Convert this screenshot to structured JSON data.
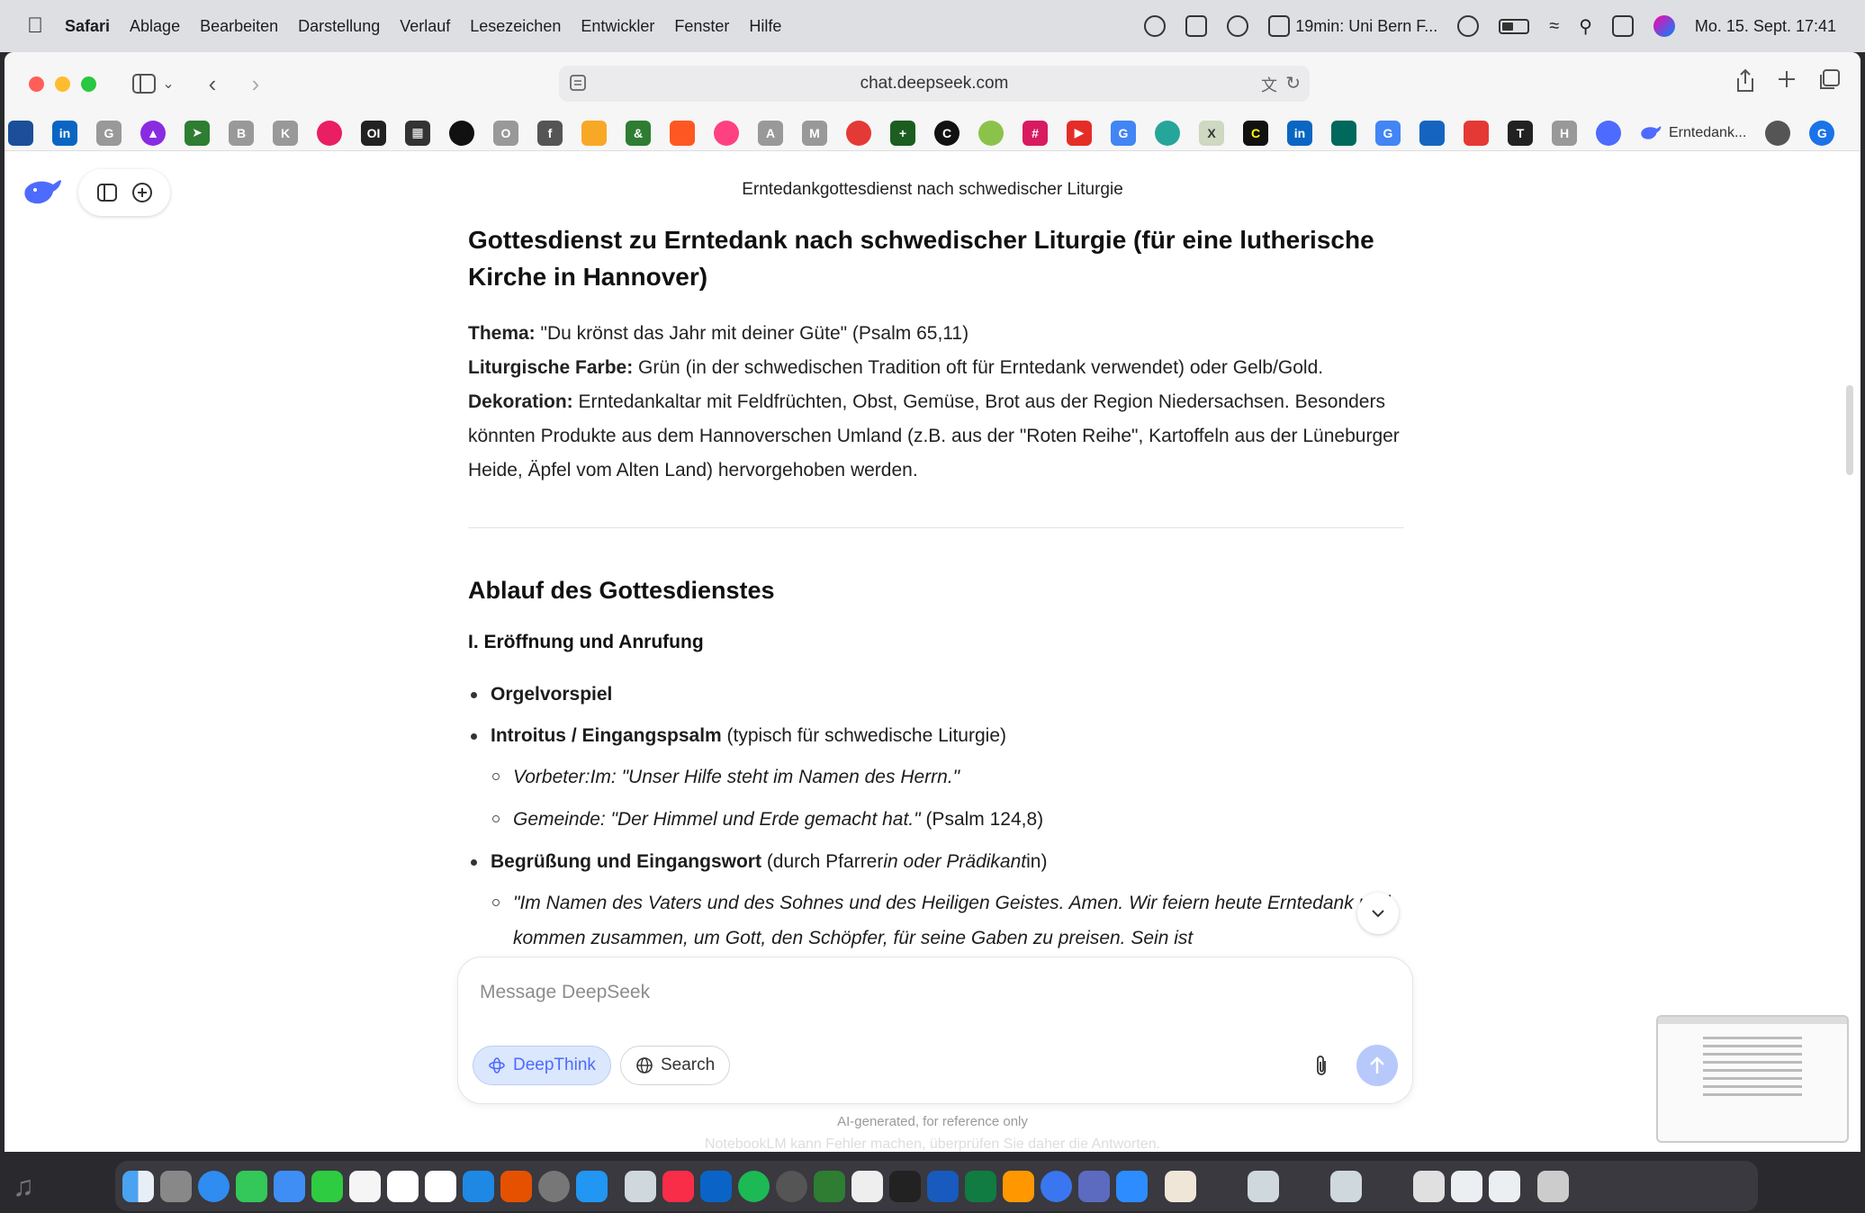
{
  "menubar": {
    "app_name": "Safari",
    "menus": [
      "Ablage",
      "Bearbeiten",
      "Darstellung",
      "Verlauf",
      "Lesezeichen",
      "Entwickler",
      "Fenster",
      "Hilfe"
    ],
    "meeting": "19min:  Uni Bern F...",
    "datetime": "Mo. 15. Sept.  17:41"
  },
  "browser": {
    "url": "chat.deepseek.com",
    "active_tab_label": "Erntedank..."
  },
  "chat": {
    "title": "Erntedankgottesdienst nach schwedischer Liturgie",
    "heading": "Gottesdienst zu Erntedank nach schwedischer Liturgie (für eine lutherische Kirche in Hannover)",
    "info": {
      "thema_label": "Thema:",
      "thema_value": "\"Du krönst das Jahr mit deiner Güte\" (Psalm 65,11)",
      "farbe_label": "Liturgische Farbe:",
      "farbe_value": "Grün (in der schwedischen Tradition oft für Erntedank verwendet) oder Gelb/Gold.",
      "deko_label": "Dekoration:",
      "deko_value": "Erntedankaltar mit Feldfrüchten, Obst, Gemüse, Brot aus der Region Niedersachsen. Besonders könnten Produkte aus dem Hannoverschen Umland (z.B. aus der \"Roten Reihe\", Kartoffeln aus der Lüneburger Heide, Äpfel vom Alten Land) hervorgehoben werden."
    },
    "section_heading": "Ablauf des Gottesdienstes",
    "subsection_heading": "I. Eröffnung und Anrufung",
    "items": {
      "orgel": "Orgelvorspiel",
      "introitus_bold": "Introitus / Eingangspsalm",
      "introitus_rest": " (typisch für schwedische Liturgie)",
      "vorbeter": "Vorbeter:Im: \"Unser Hilfe steht im Namen des Herrn.\"",
      "gemeinde_italic": "Gemeinde: \"Der Himmel und Erde gemacht hat.\"",
      "gemeinde_ref": " (Psalm 124,8)",
      "begruessung_bold": "Begrüßung und Eingangswort",
      "begruessung_pre": " (durch Pfarrer",
      "begruessung_italic": "in oder Prädikant",
      "begruessung_post": "in)",
      "quote": "\"Im Namen des Vaters und des Sohnes und des Heiligen Geistes. Amen. Wir feiern heute Erntedank und kommen zusammen, um Gott, den Schöpfer, für seine Gaben zu preisen. Sein ist"
    }
  },
  "composer": {
    "placeholder": "Message DeepSeek",
    "deepthink_label": "DeepThink",
    "search_label": "Search",
    "disclaimer": "AI-generated, for reference only"
  },
  "background_text": "NotebookLM kann Fehler machen, überprüfen Sie daher die Antworten.",
  "colors": {
    "accent": "#4d6bfe",
    "send_disabled": "#b7c9fb"
  }
}
